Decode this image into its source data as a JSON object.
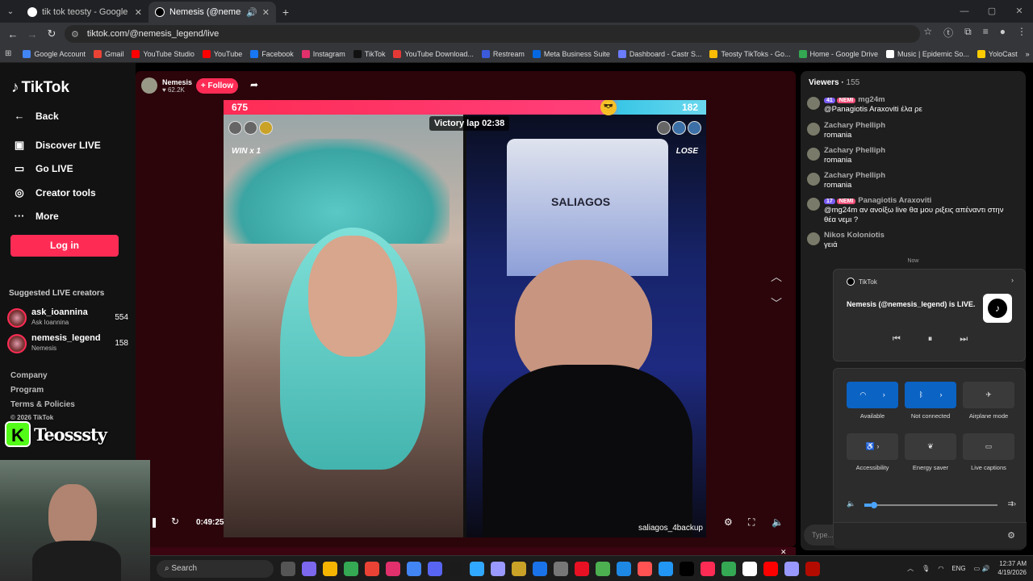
{
  "browser": {
    "tabs": [
      {
        "title": "tik tok teosty - Google Search",
        "active": false
      },
      {
        "title": "Nemesis (@nemesis_legend",
        "active": true
      }
    ],
    "url": "tiktok.com/@nemesis_legend/live",
    "bookmarks": [
      "Google Account",
      "Gmail",
      "YouTube Studio",
      "YouTube",
      "Facebook",
      "Instagram",
      "TikTok",
      "YouTube Download...",
      "Restream",
      "Meta Business Suite",
      "Dashboard - Castr S...",
      "Teosty TikToks - Go...",
      "Home - Google Drive",
      "Music | Epidemic So...",
      "YoloCast"
    ]
  },
  "sidebar": {
    "logo": "TikTok",
    "nav": [
      {
        "label": "Back"
      },
      {
        "label": "Discover LIVE"
      },
      {
        "label": "Go LIVE"
      },
      {
        "label": "Creator tools"
      },
      {
        "label": "More"
      }
    ],
    "login": "Log in",
    "suggested_title": "Suggested LIVE creators",
    "creators": [
      {
        "name": "ask_ioannina",
        "sub": "Ask Ioannina",
        "count": "554"
      },
      {
        "name": "nemesis_legend",
        "sub": "Nemesis",
        "count": "158"
      }
    ],
    "footer": [
      "Company",
      "Program",
      "Terms & Policies",
      "© 2026 TikTok"
    ]
  },
  "overlay": {
    "k": "K",
    "name": "Teosssty"
  },
  "live": {
    "host_name": "Nemesis",
    "host_viewers": "62.2K",
    "follow": "+ Follow",
    "left_score": "675",
    "right_score": "182",
    "victory": "Victory lap 02:38",
    "win": "WIN x 1",
    "lose": "LOSE",
    "jersey": "SALIAGOS",
    "opponent": "saliagos_4backup",
    "time": "0:49:25"
  },
  "chat": {
    "title": "Viewers",
    "count": "155",
    "messages": [
      {
        "name": "mg24m",
        "level": "41",
        "fan": "NEMI",
        "text": "@Panagiotis Araxoviti έλα ρε"
      },
      {
        "name": "Zachary Phelliph",
        "level": "",
        "fan": "",
        "text": "romania"
      },
      {
        "name": "Zachary Phelliph",
        "level": "",
        "fan": "",
        "text": "romania"
      },
      {
        "name": "Zachary Phelliph",
        "level": "",
        "fan": "",
        "text": "romania"
      },
      {
        "name": "Panagiotis Araxoviti",
        "level": "17",
        "fan": "NEMI",
        "text": "@mg24m αν ανοίξω live θα μου ριξεις απέναντι στην θέα νεμι ?"
      },
      {
        "name": "Nikos Koloniotis",
        "level": "",
        "fan": "",
        "text": "γειά"
      }
    ],
    "now": "Now",
    "input_placeholder": "Type..."
  },
  "notification": {
    "app": "TikTok",
    "text": "Nemesis (@nemesis_legend) is LIVE..."
  },
  "quick_settings": {
    "tiles": [
      {
        "label": "Available"
      },
      {
        "label": "Not connected"
      },
      {
        "label": "Airplane mode"
      },
      {
        "label": "Accessibility"
      },
      {
        "label": "Energy saver"
      },
      {
        "label": "Live captions"
      }
    ],
    "volume_percent": 5
  },
  "taskbar": {
    "search": "Search",
    "lang": "ENG",
    "time": "12:37 AM",
    "date": "4/19/2026"
  },
  "colors": {
    "accent": "#fe2c55",
    "win_blue": "#0b63c4"
  }
}
